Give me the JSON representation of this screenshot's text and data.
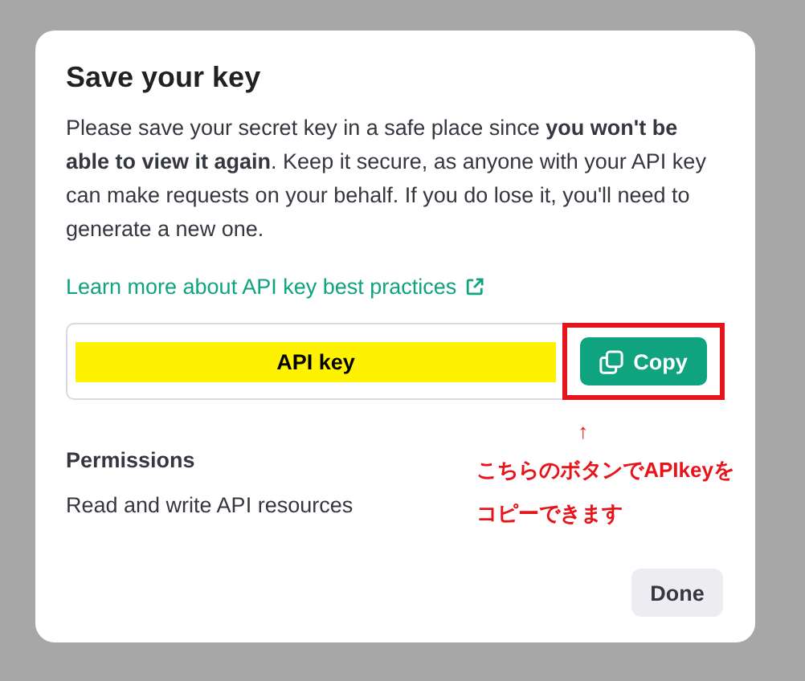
{
  "dialog": {
    "title": "Save your key",
    "message": "Please save your secret key in a safe place since **you won't be able to view it again**. Keep it secure, as anyone with your API key can make requests on your behalf. If you do lose it, you'll need to generate a new one.",
    "link": "Learn more about API key best practices",
    "key_field": {
      "value": "API key",
      "copy_button": "Copy",
      "highlighted": true
    },
    "permissions": {
      "title": "Permissions",
      "value": "Read and write API resources"
    },
    "annotation": {
      "arrow": "↑",
      "lines": [
        "こちらのボタンでAPIkeyを",
        "コピーできます"
      ]
    },
    "done_button": "Done"
  }
}
